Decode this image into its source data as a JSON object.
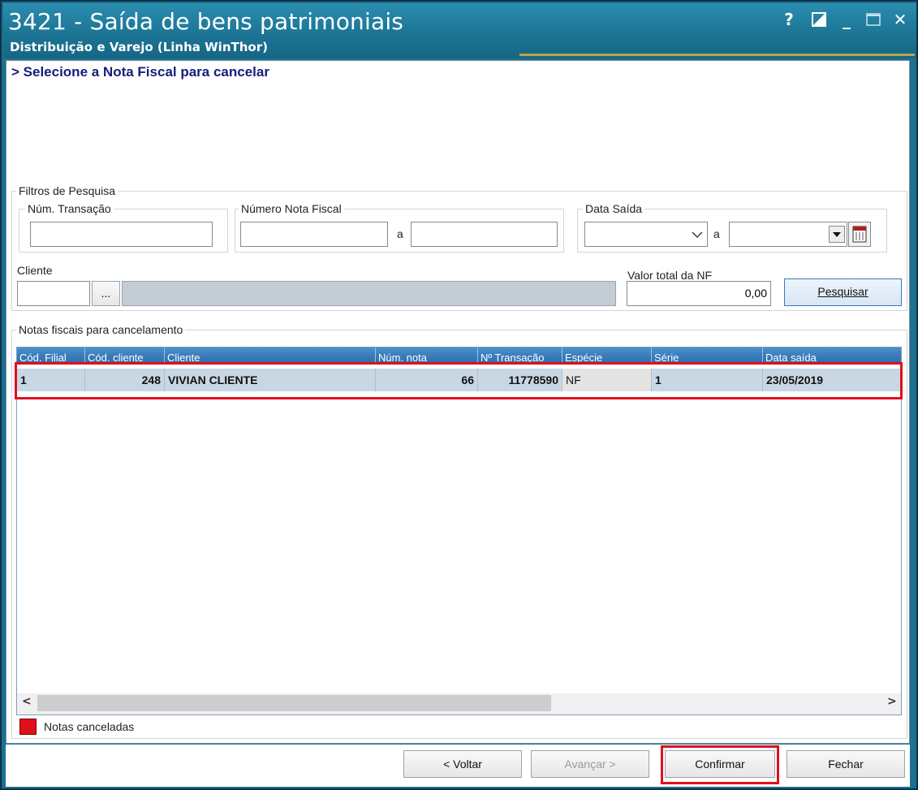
{
  "window": {
    "title": "3421 - Saída de bens patrimoniais",
    "subtitle": "Distribuição e Varejo (Linha WinThor)",
    "help_label": "?",
    "minimize_label": "_",
    "close_label": "✕"
  },
  "step_title": "> Selecione a Nota Fiscal para cancelar",
  "filters": {
    "group_label": "Filtros de Pesquisa",
    "num_transacao": {
      "label": "Núm. Transação",
      "value": ""
    },
    "numero_nota": {
      "label": "Número Nota Fiscal",
      "from": "",
      "separator": "a",
      "to": ""
    },
    "data_saida": {
      "label": "Data Saída",
      "from": "",
      "separator": "a",
      "to": ""
    },
    "cliente": {
      "label": "Cliente",
      "code": "",
      "browse_label": "...",
      "name": ""
    },
    "valor_total": {
      "label": "Valor total da NF",
      "value": "0,00"
    },
    "search_button": "Pesquisar"
  },
  "notas": {
    "group_label": "Notas fiscais para cancelamento",
    "columns": [
      "Cód. Filial",
      "Cód. cliente",
      "Cliente",
      "Núm. nota",
      "Nº Transação",
      "Espécie",
      "Série",
      "Data saída"
    ],
    "rows": [
      {
        "cod_filial": "1",
        "cod_cliente": "248",
        "cliente": "VIVIAN CLIENTE",
        "num_nota": "66",
        "num_transacao": "11778590",
        "especie": "NF",
        "serie": "1",
        "data_saida": "23/05/2019"
      }
    ]
  },
  "legend": {
    "label": "Notas canceladas",
    "color": "#e0101a"
  },
  "scroll": {
    "left_arrow": "<",
    "right_arrow": ">"
  },
  "footer": {
    "back_label": "< Voltar",
    "next_label": "Avançar >",
    "confirm_label": "Confirmar",
    "close_label": "Fechar"
  },
  "colors": {
    "titlebar": "#1c7595",
    "highlight": "#e0101a",
    "selected_row": "#c9d6e3"
  }
}
